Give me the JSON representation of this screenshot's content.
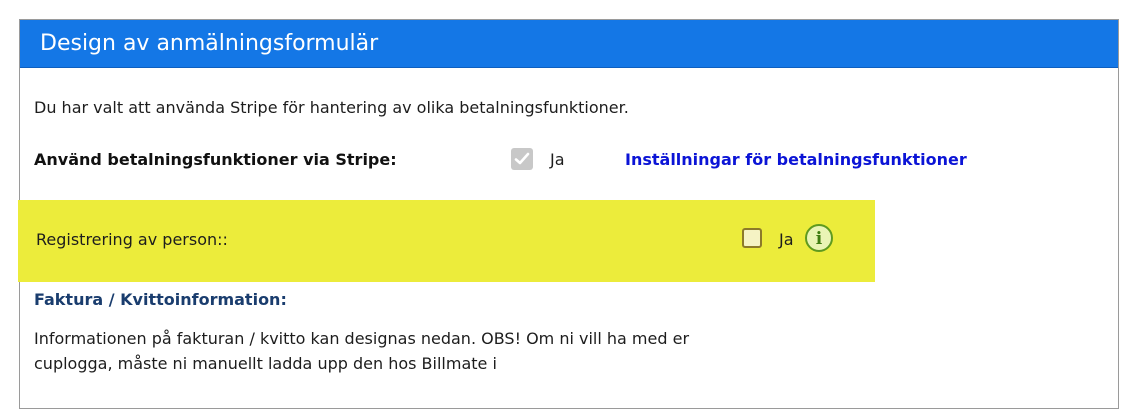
{
  "panel": {
    "title": "Design av anmälningsformulär"
  },
  "intro_text": "Du har valt att använda Stripe för hantering av olika betalningsfunktioner.",
  "stripe": {
    "label": "Använd betalningsfunktioner via Stripe:",
    "checked": true,
    "option_label": "Ja",
    "settings_link": "Inställningar för betalningsfunktioner"
  },
  "registration": {
    "label": "Registrering av person::",
    "checked": false,
    "option_label": "Ja",
    "info_icon": "info-icon",
    "info_glyph": "i",
    "highlight_color": "#ecec3b"
  },
  "invoice": {
    "heading": "Faktura / Kvittoinformation:",
    "description": "Informationen på fakturan / kvitto kan designas nedan. OBS! Om ni vill ha med er cuplogga, måste ni manuellt ladda upp den hos Billmate i"
  },
  "colors": {
    "header": "#1477e6",
    "link": "#0b14d6",
    "heading": "#1a3d6e"
  }
}
